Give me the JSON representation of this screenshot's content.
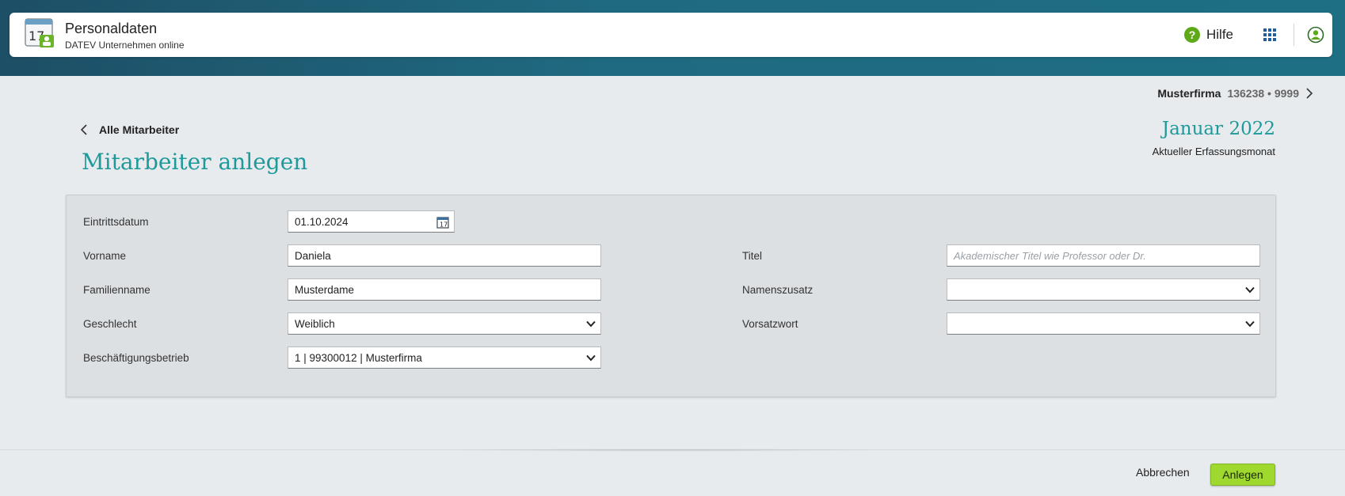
{
  "header": {
    "app_title": "Personaldaten",
    "app_subtitle": "DATEV Unternehmen online",
    "app_icon_day": "17",
    "help_label": "Hilfe",
    "help_glyph": "?"
  },
  "company": {
    "name": "Musterfirma",
    "number": "136238 • 9999"
  },
  "nav": {
    "back_label": "Alle Mitarbeiter"
  },
  "page": {
    "title": "Mitarbeiter anlegen",
    "month": "Januar 2022",
    "month_caption": "Aktueller Erfassungsmonat"
  },
  "form": {
    "eintrittsdatum": {
      "label": "Eintrittsdatum",
      "value": "01.10.2024"
    },
    "vorname": {
      "label": "Vorname",
      "value": "Daniela"
    },
    "familienname": {
      "label": "Familienname",
      "value": "Musterdame"
    },
    "geschlecht": {
      "label": "Geschlecht",
      "value": "Weiblich"
    },
    "betrieb": {
      "label": "Beschäftigungsbetrieb",
      "value": "1 | 99300012 | Musterfirma"
    },
    "titel": {
      "label": "Titel",
      "value": "",
      "placeholder": "Akademischer Titel wie Professor oder Dr."
    },
    "namenszusatz": {
      "label": "Namenszusatz",
      "value": ""
    },
    "vorsatzwort": {
      "label": "Vorsatzwort",
      "value": ""
    }
  },
  "footer": {
    "cancel_label": "Abbrechen",
    "create_label": "Anlegen"
  },
  "colors": {
    "accent_teal": "#1e9a9a",
    "primary_green": "#9fd82e",
    "header_bg": "#1f6a80"
  },
  "icons": [
    "calendar-app-icon",
    "help-icon",
    "apps-grid-icon",
    "user-icon",
    "chevron-right-icon",
    "chevron-left-icon",
    "calendar-icon",
    "chevron-down-icon"
  ]
}
